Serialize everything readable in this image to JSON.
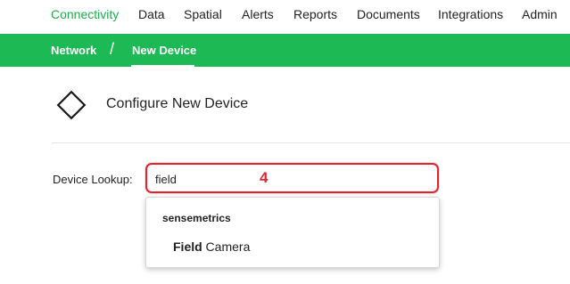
{
  "topnav": {
    "items": [
      {
        "label": "Connectivity",
        "active": true
      },
      {
        "label": "Data"
      },
      {
        "label": "Spatial"
      },
      {
        "label": "Alerts"
      },
      {
        "label": "Reports"
      },
      {
        "label": "Documents"
      },
      {
        "label": "Integrations"
      },
      {
        "label": "Admin"
      }
    ]
  },
  "breadcrumb": {
    "items": [
      {
        "label": "Network"
      },
      {
        "label": "New Device",
        "active": true
      }
    ],
    "separator": "/"
  },
  "page": {
    "icon": "diamond-icon",
    "title": "Configure New Device"
  },
  "lookup": {
    "label": "Device Lookup:",
    "value": "field",
    "step_badge": "4"
  },
  "dropdown": {
    "group": "sensemetrics",
    "options": [
      {
        "match": "Field",
        "rest": " Camera"
      }
    ]
  },
  "colors": {
    "accent_green": "#1db954",
    "active_text_green": "#1aad4b",
    "highlight_red": "#e0252f"
  }
}
